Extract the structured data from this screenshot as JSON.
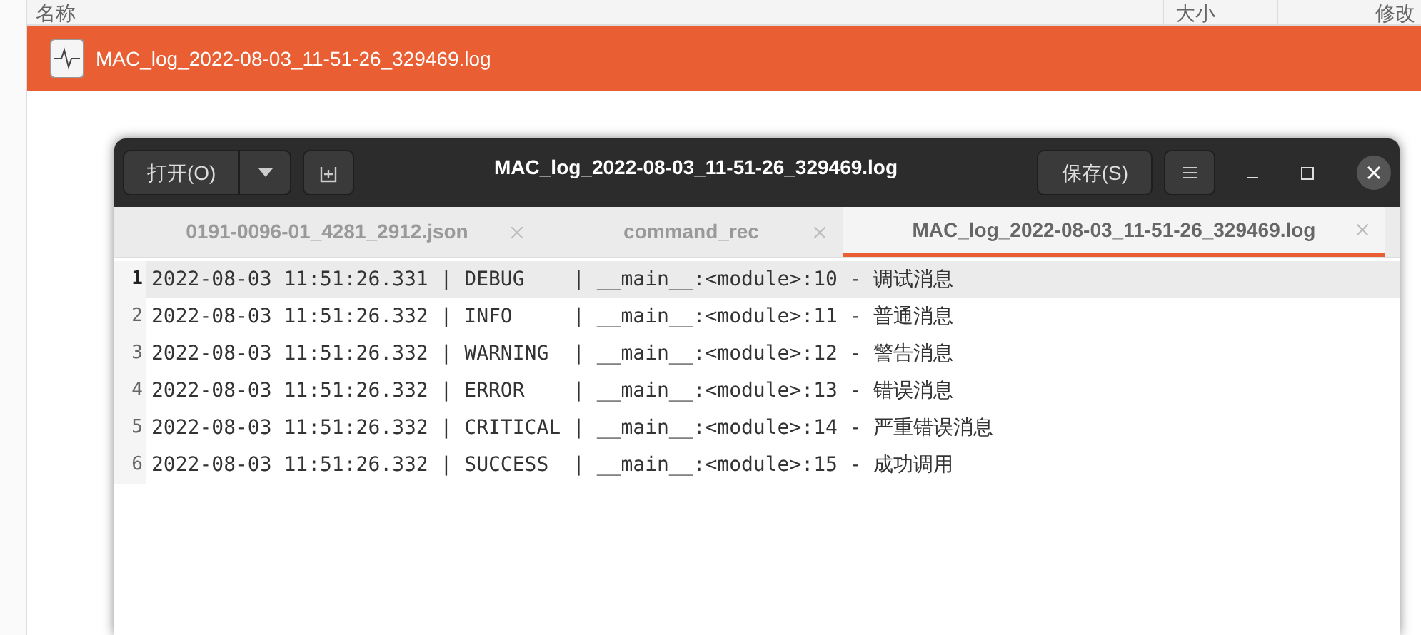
{
  "file_list": {
    "columns": [
      "名称",
      "大小",
      "修改"
    ],
    "rows": [
      {
        "name": "MAC_log_2022-08-03_11-51-26_329469.log",
        "selected": true
      }
    ]
  },
  "editor": {
    "open_button": "打开(O)",
    "title": "MAC_log_2022-08-03_11-51-26_329469.log",
    "save_button": "保存(S)",
    "tabs": [
      {
        "label": "0191-0096-01_4281_2912.json",
        "selected": false
      },
      {
        "label": "command_rec",
        "selected": false
      },
      {
        "label": "MAC_log_2022-08-03_11-51-26_329469.log",
        "selected": true
      }
    ],
    "lines": [
      {
        "number": "1",
        "text": "2022-08-03 11:51:26.331 | DEBUG    | __main__:<module>:10 - 调试消息",
        "current": true
      },
      {
        "number": "2",
        "text": "2022-08-03 11:51:26.332 | INFO     | __main__:<module>:11 - 普通消息",
        "current": false
      },
      {
        "number": "3",
        "text": "2022-08-03 11:51:26.332 | WARNING  | __main__:<module>:12 - 警告消息",
        "current": false
      },
      {
        "number": "4",
        "text": "2022-08-03 11:51:26.332 | ERROR    | __main__:<module>:13 - 错误消息",
        "current": false
      },
      {
        "number": "5",
        "text": "2022-08-03 11:51:26.332 | CRITICAL | __main__:<module>:14 - 严重错误消息",
        "current": false
      },
      {
        "number": "6",
        "text": "2022-08-03 11:51:26.332 | SUCCESS  | __main__:<module>:15 - 成功调用",
        "current": false
      }
    ]
  }
}
